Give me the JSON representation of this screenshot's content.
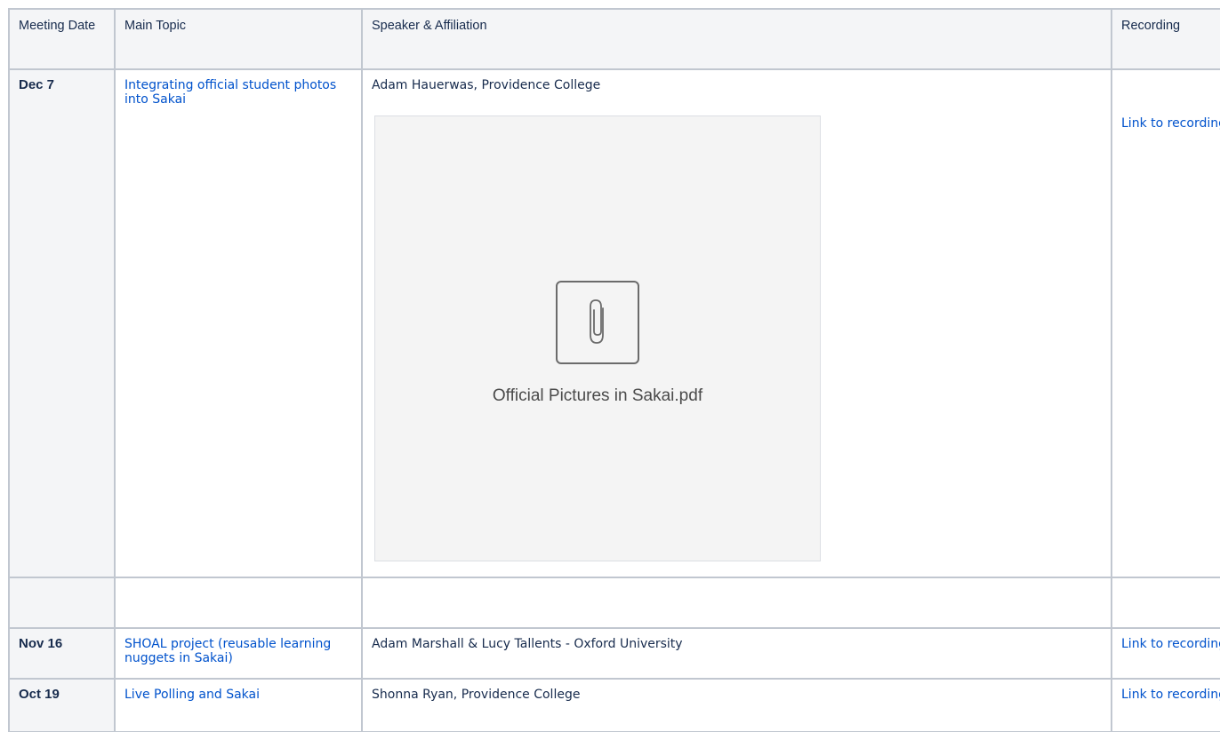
{
  "table": {
    "headers": {
      "date": "Meeting Date",
      "topic": "Main Topic",
      "speaker": "Speaker & Affiliation",
      "recording": "Recording"
    },
    "rows": [
      {
        "date": "Dec 7",
        "topic": "Integrating official student photos into Sakai",
        "speaker": "Adam Hauerwas, Providence College",
        "attachment": {
          "filename": "Official Pictures in Sakai.pdf",
          "icon": "paperclip-icon"
        },
        "recording": "Link to recording"
      },
      {
        "date": "",
        "topic": "",
        "speaker": "",
        "recording": ""
      },
      {
        "date": "Nov 16",
        "topic": "SHOAL project (reusable learning nuggets in Sakai)",
        "speaker": "Adam Marshall & Lucy Tallents - Oxford University",
        "recording": "Link to recording"
      },
      {
        "date": "Oct 19",
        "topic": "Live Polling and Sakai",
        "speaker": "Shonna Ryan, Providence College",
        "recording": "Link to recording"
      }
    ]
  },
  "colors": {
    "link": "#0052cc",
    "border": "#c1c7d0",
    "header_bg": "#f4f5f7",
    "text": "#172b4d"
  }
}
